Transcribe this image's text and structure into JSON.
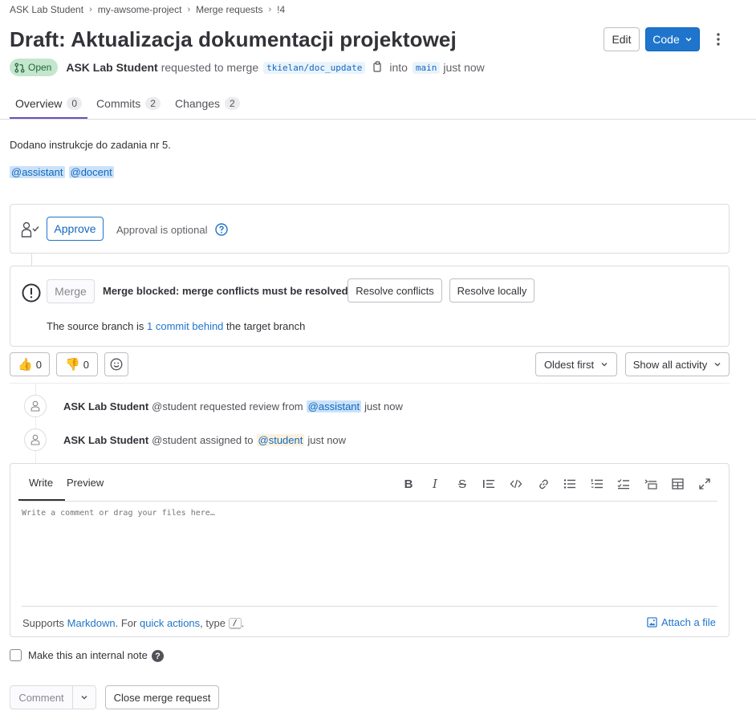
{
  "breadcrumb": [
    "ASK Lab Student",
    "my-awsome-project",
    "Merge requests",
    "!4"
  ],
  "title": "Draft: Aktualizacja dokumentacji projektowej",
  "header": {
    "edit_label": "Edit",
    "code_label": "Code"
  },
  "meta": {
    "status": "Open",
    "author": "ASK Lab Student",
    "requested_text": "requested to merge",
    "source_branch": "tkielan/doc_update",
    "into_text": "into",
    "target_branch": "main",
    "time": "just now"
  },
  "tabs": [
    {
      "label": "Overview",
      "count": "0"
    },
    {
      "label": "Commits",
      "count": "2"
    },
    {
      "label": "Changes",
      "count": "2"
    }
  ],
  "description": {
    "text": "Dodano instrukcje do zadania nr 5.",
    "mentions": [
      "@assistant",
      "@docent"
    ]
  },
  "approval": {
    "button": "Approve",
    "text": "Approval is optional"
  },
  "merge": {
    "button": "Merge",
    "blocked_text": "Merge blocked: merge conflicts must be resolved.",
    "resolve_conflicts": "Resolve conflicts",
    "resolve_locally": "Resolve locally",
    "behind_pre": "The source branch is",
    "behind_link": "1 commit behind",
    "behind_post": "the target branch"
  },
  "reactions": {
    "thumbsup": "0",
    "thumbsdown": "0"
  },
  "sort": {
    "order": "Oldest first",
    "filter": "Show all activity"
  },
  "activity": [
    {
      "author": "ASK Lab Student",
      "handle": "@student",
      "action": "requested review from",
      "mention": "@assistant",
      "time": "just now"
    },
    {
      "author": "ASK Lab Student",
      "handle": "@student",
      "action": "assigned to",
      "mention": "@student",
      "time": "just now"
    }
  ],
  "editor": {
    "write_tab": "Write",
    "preview_tab": "Preview",
    "placeholder": "Write a comment or drag your files here…",
    "supports": "Supports",
    "markdown": "Markdown",
    "for_text": ". For",
    "quick_actions": "quick actions",
    "type_text": ", type",
    "slash": "/",
    "end_dot": ".",
    "attach": "Attach a file"
  },
  "internal_note": "Make this an internal note",
  "footer": {
    "comment": "Comment",
    "close": "Close merge request"
  },
  "colors": {
    "primary": "#1f75cb",
    "open_badge_bg": "#c3e6cd",
    "open_badge_text": "#24663b",
    "tab_active": "#6b4fbb"
  }
}
